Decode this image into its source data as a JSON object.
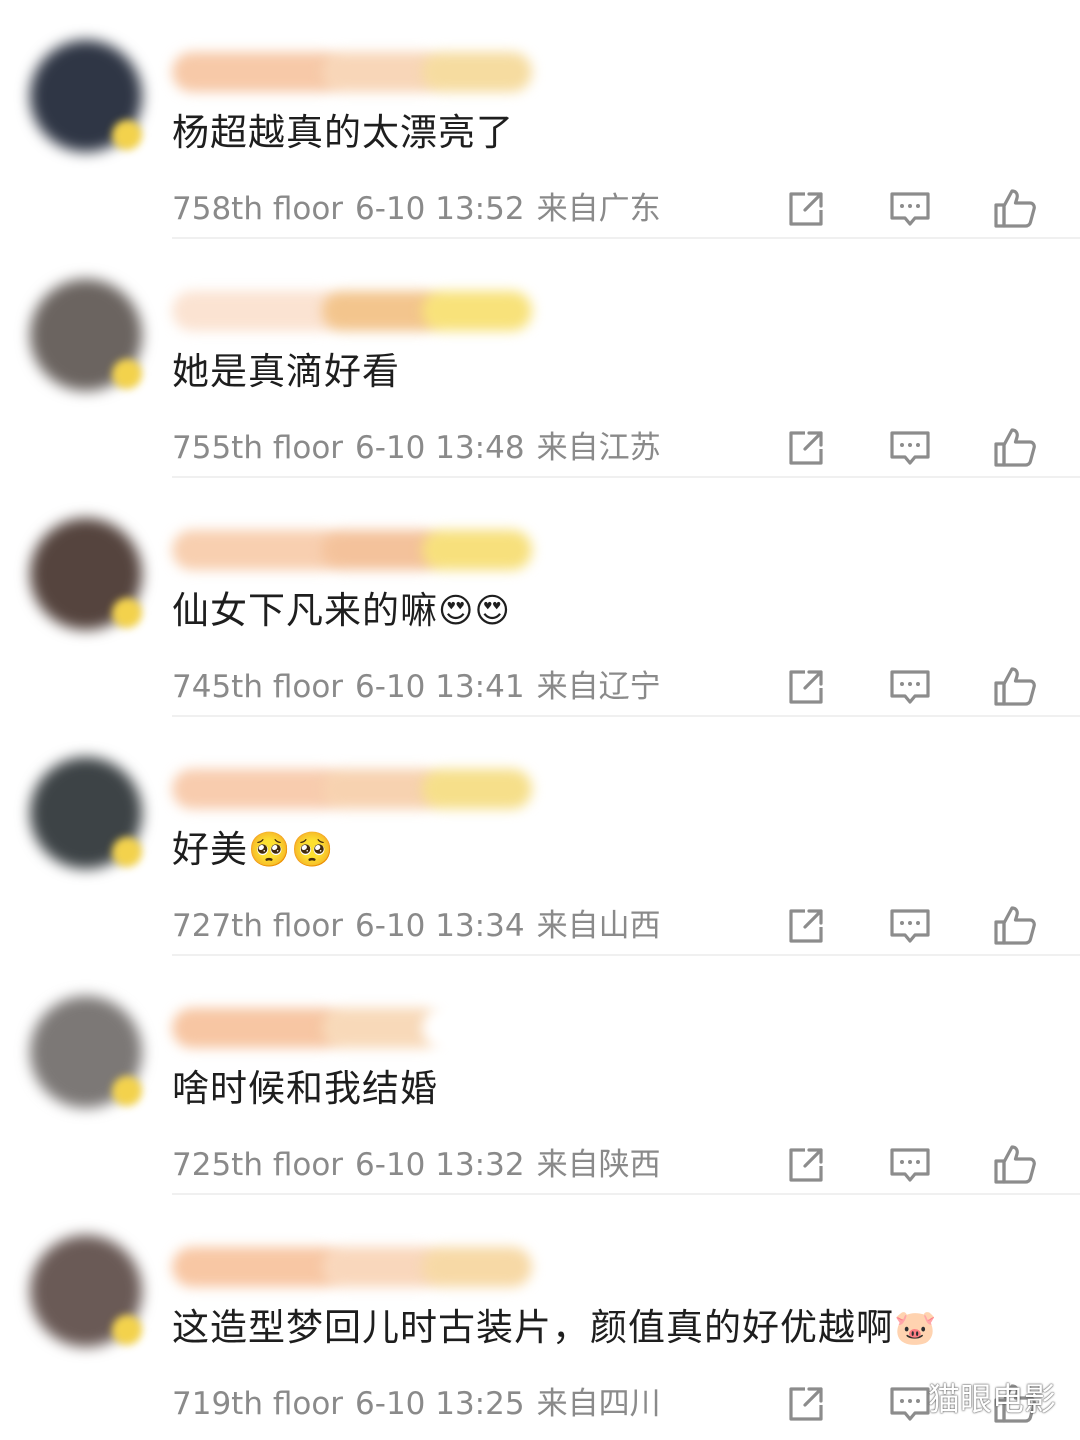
{
  "comments": [
    {
      "text": "杨超越真的太漂亮了",
      "emojis": "",
      "floor": "758th floor",
      "datetime": "6-10 13:52",
      "location": "来自广东",
      "avatar_color": "#2f3645",
      "name_colors": [
        "#f7c9a8",
        "#f8d6b8",
        "#f6dca0"
      ]
    },
    {
      "text": "她是真滴好看",
      "emojis": "",
      "floor": "755th floor",
      "datetime": "6-10 13:48",
      "location": "来自江苏",
      "avatar_color": "#6b6460",
      "name_colors": [
        "#fbe3d2",
        "#f3c58d",
        "#f8e27a"
      ]
    },
    {
      "text": "仙女下凡来的嘛",
      "emojis": "😍😍",
      "floor": "745th floor",
      "datetime": "6-10 13:41",
      "location": "来自辽宁",
      "avatar_color": "#55443e",
      "name_colors": [
        "#f8cfb0",
        "#f4c29b",
        "#f7e07c"
      ]
    },
    {
      "text": "好美",
      "emojis": "🥺🥺",
      "floor": "727th floor",
      "datetime": "6-10 13:34",
      "location": "来自山西",
      "avatar_color": "#3d4346",
      "name_colors": [
        "#f8ccae",
        "#f7d2b0",
        "#f6df8a"
      ]
    },
    {
      "text": "啥时候和我结婚",
      "emojis": "",
      "floor": "725th floor",
      "datetime": "6-10 13:32",
      "location": "来自陕西",
      "avatar_color": "#7c7876",
      "name_colors": [
        "#f7c6a3",
        "#f8d9b9",
        "#ffffff"
      ]
    },
    {
      "text": "这造型梦回儿时古装片，颜值真的好优越啊",
      "emojis": "🐷",
      "floor": "719th floor",
      "datetime": "6-10 13:25",
      "location": "来自四川",
      "avatar_color": "#6a5a56",
      "name_colors": [
        "#f8c7a4",
        "#f9d7bc",
        "#f7d9a6"
      ]
    }
  ],
  "icons": {
    "share": "share-icon",
    "reply": "reply-icon",
    "like": "thumbs-up-icon"
  },
  "watermark": "猫眼电影"
}
